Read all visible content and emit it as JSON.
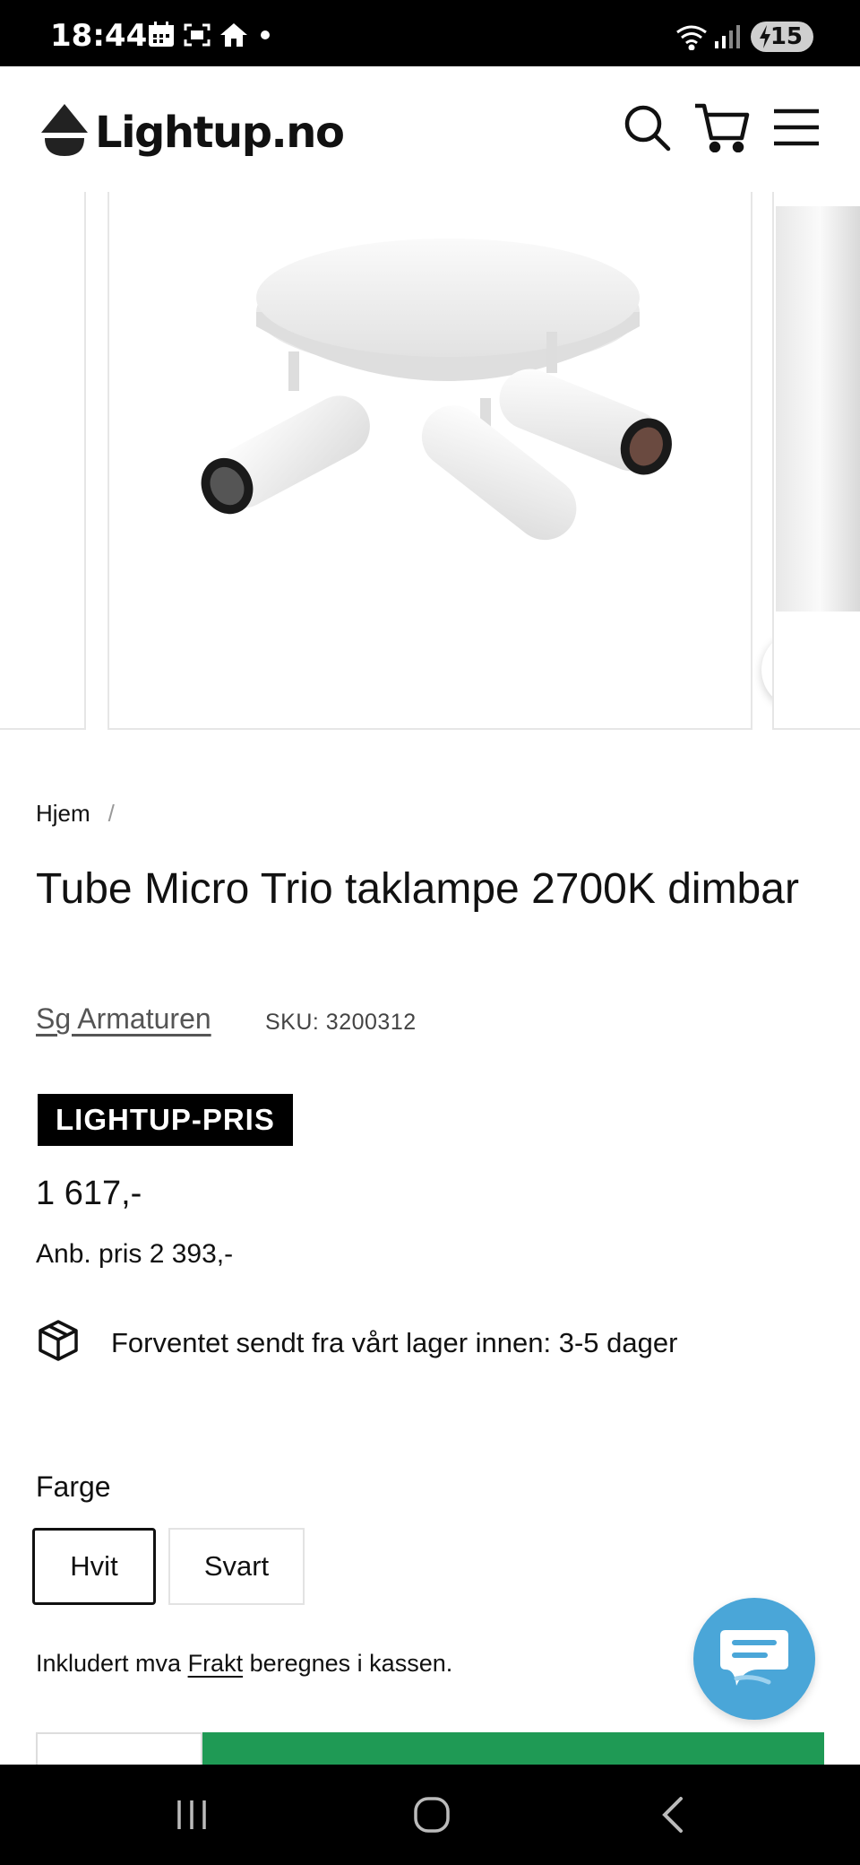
{
  "status_bar": {
    "time": "18:44",
    "battery": "15",
    "icons": [
      "calendar-icon",
      "screenshot-icon",
      "home-icon",
      "dot-icon",
      "wifi-icon",
      "signal-icon",
      "battery-charging-icon"
    ]
  },
  "header": {
    "logo_text": "Lightup.no",
    "icons": [
      "search-icon",
      "cart-icon",
      "menu-icon"
    ]
  },
  "breadcrumb": {
    "home": "Hjem",
    "separator": "/"
  },
  "product": {
    "title": "Tube Micro Trio taklampe 2700K dimbar",
    "vendor": "Sg Armaturen",
    "sku": "SKU: 3200312",
    "price_badge": "LIGHTUP-PRIS",
    "price": "1 617,-",
    "compare_price": "Anb. pris 2 393,-",
    "shipping": "Forventet sendt fra vårt lager innen: 3-5 dager"
  },
  "options": {
    "label": "Farge",
    "values": [
      "Hvit",
      "Svart"
    ],
    "selected": "Hvit"
  },
  "tax_note": {
    "prefix": "Inkludert mva ",
    "link": "Frakt",
    "suffix": " beregnes i kassen."
  },
  "colors": {
    "accent_green": "#1f9a55",
    "chat_blue": "#4aa6d8",
    "badge_bg": "#000000"
  }
}
